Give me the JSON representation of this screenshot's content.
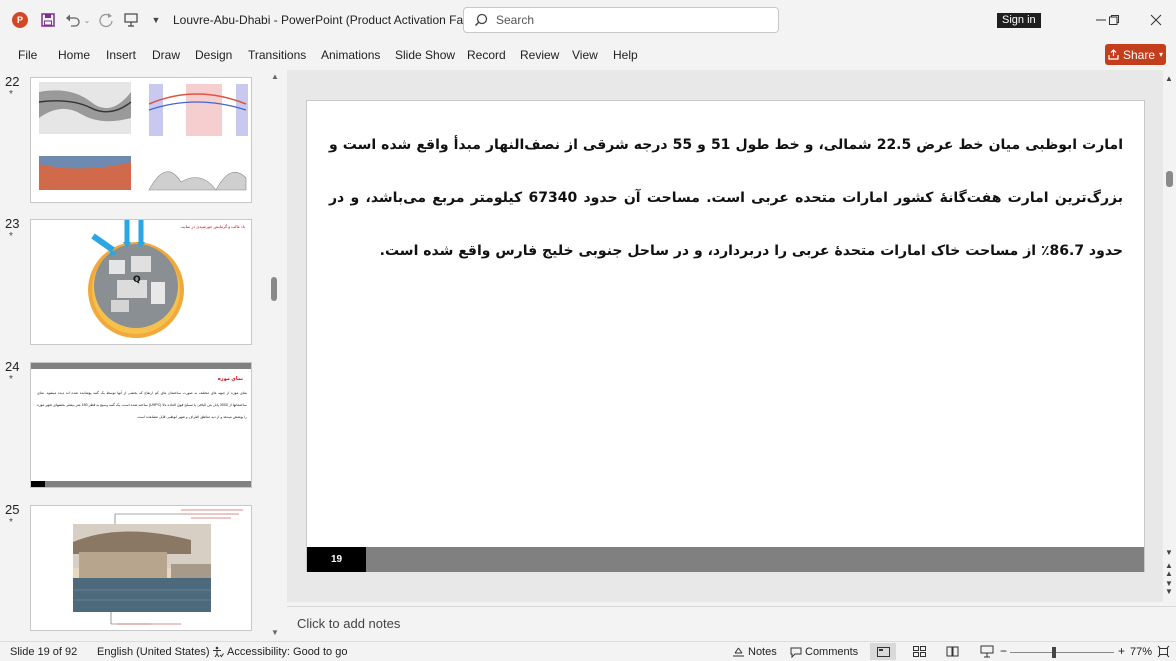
{
  "window": {
    "title": "Louvre-Abu-Dhabi  -  PowerPoint (Product Activation Fa...",
    "search_placeholder": "Search",
    "signin_label": "Sign in",
    "share_label": "Share"
  },
  "menu": [
    "File",
    "Home",
    "Insert",
    "Draw",
    "Design",
    "Transitions",
    "Animations",
    "Slide Show",
    "Record",
    "Review",
    "View",
    "Help"
  ],
  "thumbnails": [
    {
      "num": "22",
      "star": "*"
    },
    {
      "num": "23",
      "star": "*",
      "caption": "باد غالب و گرمایش خورشیدی در سایت"
    },
    {
      "num": "24",
      "star": "*",
      "title": "نمای موزه",
      "body": "نمای موزه از جبهه های مختلف به صورت ساختمان های کم ارتفاع که بخشی از آنها توسط یک گنبد پوشانده شده اند دیده میشود. نمای ساختمانها از 3000 پانل بتن الیافی یا مسلح فوق العاده بالا (UHPC) ساخته شده است. یک گنبد وسیع به قطر 180 متر بیشتر بخشهای شهر موزه را پوشش میدهد و از دید مناطق اطراف و شهر ابوظبی قابل مشاهده است."
    },
    {
      "num": "25",
      "star": "*"
    }
  ],
  "slide": {
    "number": "19",
    "text": "امارت ابوظبی میان خط عرض 22.5 شمالی، و خط طول 51 و 55 درجه شرقی از نصف‌النهار مبدأ واقع شده است و بزرگ‌ترین امارت هفت‌گانهٔ کشور امارات متحده عربی است. مساحت آن حدود 67340 کیلومتر مربع می‌باشد، و در حدود 86.7٪ از مساحت خاک امارات متحدهٔ عربی را دربردارد، و در ساحل جنوبی خلیج فارس واقع شده است."
  },
  "notes_placeholder": "Click to add notes",
  "status": {
    "slide_count": "Slide 19 of 92",
    "language": "English (United States)",
    "accessibility": "Accessibility: Good to go",
    "notes_label": "Notes",
    "comments_label": "Comments",
    "zoom": "77%"
  },
  "colors": {
    "accent": "#c43e1c",
    "ribbon_bg": "#f3f3f3",
    "slide_footer": "#808080"
  }
}
